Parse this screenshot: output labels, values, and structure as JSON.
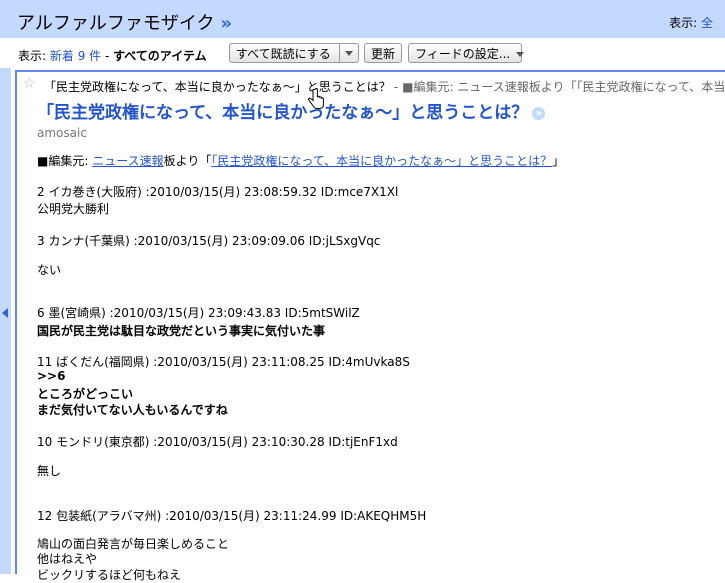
{
  "header": {
    "feed_title": "アルファルファモザイク",
    "feed_title_chevron": "»",
    "view_label": "表示:",
    "view_option": "全"
  },
  "toolbar": {
    "show_label": "表示:",
    "new_count": "新着 9 件",
    "separator": " - ",
    "all_items": "すべてのアイテム",
    "mark_all_read": "すべて既読にする",
    "refresh": "更新",
    "feed_settings": "フィードの設定..."
  },
  "entry": {
    "collapsed_title": "「民主党政権になって、本当に良かったなぁ～」と思うことは？",
    "collapsed_snippet": "- ■編集元: ニュース速報板より「「民主党政権になって、本当",
    "title": "「民主党政権になって、本当に良かったなぁ～」と思うことは？",
    "title_go": "»",
    "author": "amosaic",
    "source_prefix": "■編集元: ",
    "source_link": "ニュース速報",
    "source_middle": "板より「",
    "source_thread_link": "「民主党政権になって、本当に良かったなぁ～」と思うことは？",
    "source_suffix": "」",
    "posts": [
      {
        "header": "2 イカ巻き(大阪府) :2010/03/15(月) 23:08:59.32 ID:mce7X1Xl",
        "body": [
          "公明党大勝利"
        ],
        "bold": false
      },
      {
        "header": "3 カンナ(千葉県) :2010/03/15(月) 23:09:09.06 ID:jLSxgVqc",
        "body": [
          "ない"
        ],
        "bold": false
      },
      {
        "header": "6 墨(宮崎県) :2010/03/15(月) 23:09:43.83 ID:5mtSWilZ",
        "body": [
          "国民が民主党は駄目な政党だという事実に気付いた事"
        ],
        "bold": true
      },
      {
        "header": "11 ばくだん(福岡県) :2010/03/15(月) 23:11:08.25 ID:4mUvka8S",
        "body": [
          ">>6",
          "ところがどっこい",
          "まだ気付いてない人もいるんですね"
        ],
        "bold": true
      },
      {
        "header": "10 モンドリ(東京都) :2010/03/15(月) 23:10:30.28 ID:tjEnF1xd",
        "body": [
          "無し"
        ],
        "bold": false
      },
      {
        "header": "12 包装紙(アラバマ州) :2010/03/15(月) 23:11:24.99 ID:AKEQHM5H",
        "body": [
          "鳩山の面白発言が毎日楽しめること",
          "他はねえや",
          "ビックリするほど何もねえ"
        ],
        "bold": false
      }
    ]
  }
}
